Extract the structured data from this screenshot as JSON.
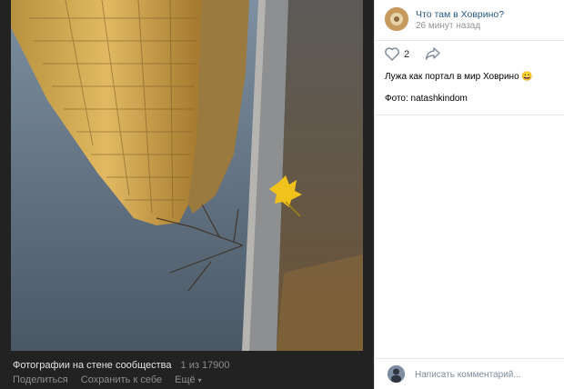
{
  "viewer": {
    "album_title": "Фотографии на стене сообщества",
    "counter": "1 из 17900",
    "share_label": "Поделиться",
    "save_label": "Сохранить к себе",
    "more_label": "Ещё"
  },
  "post": {
    "group_name": "Что там в Ховрино?",
    "time": "26 минут назад",
    "likes": "2",
    "text": "Лужа как портал в мир Ховрино 😀",
    "caption": "Фото: natashkindom"
  },
  "comment": {
    "placeholder": "Написать комментарий..."
  },
  "colors": {
    "viewer_bg": "#222222",
    "link": "#2a5885",
    "muted": "#939393"
  },
  "icons": [
    "heart-icon",
    "share-arrow-icon",
    "chevron-down-icon"
  ]
}
